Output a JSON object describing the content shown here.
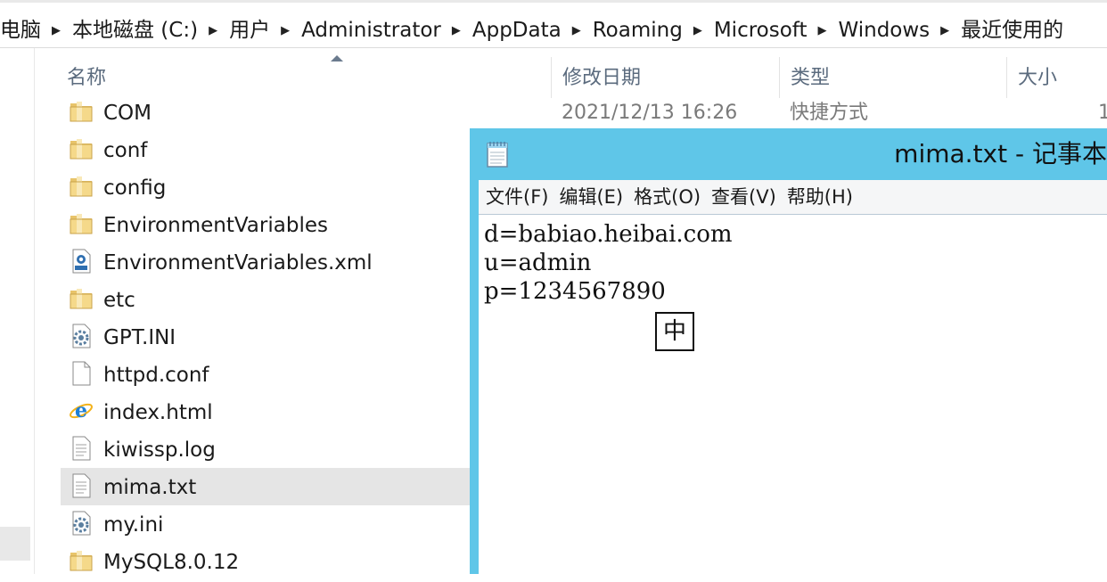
{
  "breadcrumb": [
    "电脑",
    "本地磁盘 (C:)",
    "用户",
    "Administrator",
    "AppData",
    "Roaming",
    "Microsoft",
    "Windows",
    "最近使用的"
  ],
  "columns": {
    "name": "名称",
    "date": "修改日期",
    "type": "类型",
    "size": "大小"
  },
  "files": [
    {
      "name": "COM",
      "icon": "folder-icon",
      "date": "2021/12/13 16:26",
      "type": "快捷方式",
      "size": "1"
    },
    {
      "name": "conf",
      "icon": "folder-icon"
    },
    {
      "name": "config",
      "icon": "folder-icon"
    },
    {
      "name": "EnvironmentVariables",
      "icon": "folder-icon"
    },
    {
      "name": "EnvironmentVariables.xml",
      "icon": "xml-file-icon"
    },
    {
      "name": "etc",
      "icon": "folder-icon"
    },
    {
      "name": "GPT.INI",
      "icon": "config-file-icon"
    },
    {
      "name": "httpd.conf",
      "icon": "blank-file-icon"
    },
    {
      "name": "index.html",
      "icon": "ie-html-icon"
    },
    {
      "name": "kiwissp.log",
      "icon": "text-file-icon"
    },
    {
      "name": "mima.txt",
      "icon": "text-file-icon",
      "selected": true
    },
    {
      "name": "my.ini",
      "icon": "config-file-icon"
    },
    {
      "name": "MySQL8.0.12",
      "icon": "folder-icon"
    }
  ],
  "notepad": {
    "title": "mima.txt - 记事本",
    "menu": [
      "文件(F)",
      "编辑(E)",
      "格式(O)",
      "查看(V)",
      "帮助(H)"
    ],
    "lines": [
      "d=babiao.heibai.com",
      "u=admin",
      "p=1234567890"
    ],
    "ime_indicator": "中"
  },
  "colors": {
    "notepad_frame": "#5fc6e8",
    "header_text": "#5b6b7e",
    "selected_row": "#e5e5e5"
  }
}
